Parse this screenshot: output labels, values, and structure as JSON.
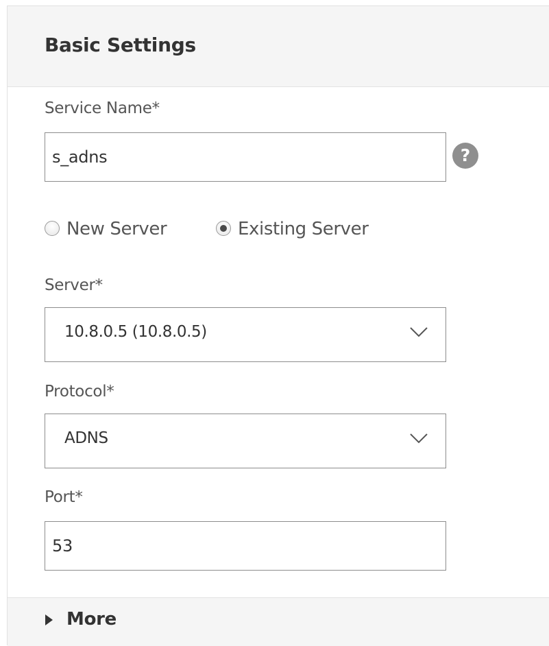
{
  "panel": {
    "title": "Basic Settings"
  },
  "service_name": {
    "label": "Service Name*",
    "value": "s_adns",
    "help_icon": "question-circle-icon",
    "help_glyph": "?"
  },
  "server_choice": {
    "options": [
      {
        "label": "New Server",
        "selected": false
      },
      {
        "label": "Existing Server",
        "selected": true
      }
    ]
  },
  "server": {
    "label": "Server*",
    "value": "10.8.0.5 (10.8.0.5)",
    "icon": "chevron-down-icon"
  },
  "protocol": {
    "label": "Protocol*",
    "value": "ADNS",
    "icon": "chevron-down-icon"
  },
  "port": {
    "label": "Port*",
    "value": "53"
  },
  "more": {
    "label": "More",
    "icon": "triangle-right-icon"
  },
  "colors": {
    "header_bg": "#f5f5f5",
    "border": "#8c8c8c",
    "text": "#333333",
    "help_icon": "#8f8f8f"
  }
}
